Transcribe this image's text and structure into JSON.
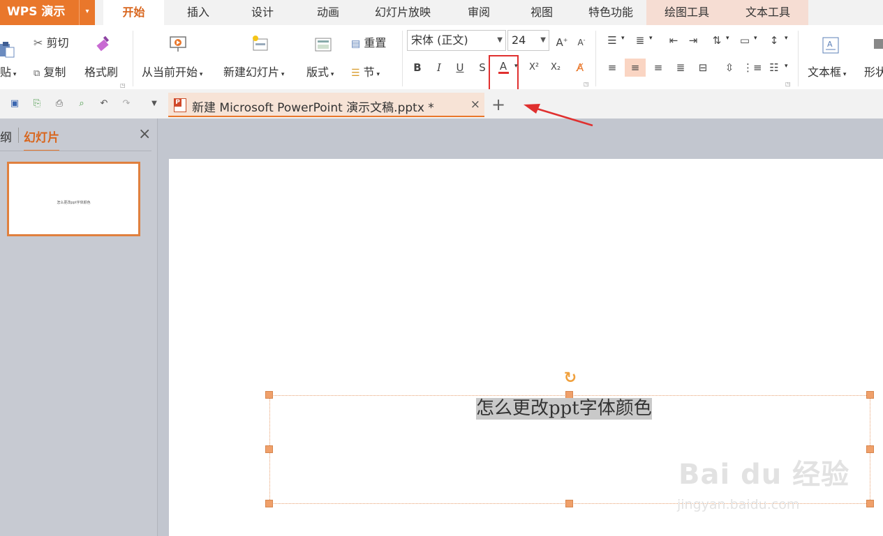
{
  "app": {
    "name": "WPS 演示",
    "caret": "▾"
  },
  "tabs": [
    {
      "label": "开始"
    },
    {
      "label": "插入"
    },
    {
      "label": "设计"
    },
    {
      "label": "动画"
    },
    {
      "label": "幻灯片放映"
    },
    {
      "label": "审阅"
    },
    {
      "label": "视图"
    },
    {
      "label": "特色功能"
    },
    {
      "label": "绘图工具"
    },
    {
      "label": "文本工具"
    }
  ],
  "toolbar": {
    "paste": "贴",
    "cut": "剪切",
    "copy": "复制",
    "format_painter": "格式刷",
    "from_current": "从当前开始",
    "new_slide": "新建幻灯片",
    "layout": "版式",
    "reset": "重置",
    "section": "节",
    "font_name": "宋体 (正文)",
    "font_size": "24",
    "text_box": "文本框",
    "shape": "形状",
    "bold": "B",
    "italic": "I",
    "underline": "U",
    "strike": "S",
    "font_color": "A",
    "superscript": "X²",
    "subscript": "X₂"
  },
  "accent": {
    "orange": "#e9772b",
    "red_highlight": "#e0302f",
    "font_color_bar": "#e0302f"
  },
  "document_tab": {
    "title": "新建 Microsoft PowerPoint 演示文稿.pptx *",
    "close": "×",
    "new": "+"
  },
  "sidebar": {
    "tab_outline": "纲",
    "tab_slides": "幻灯片",
    "close": "×",
    "thumb_text": "怎么更改ppt字体颜色"
  },
  "slide": {
    "text": "怎么更改ppt字体颜色"
  },
  "watermark": {
    "brand": "Bai du 经验",
    "url": "jingyan.baidu.com"
  }
}
